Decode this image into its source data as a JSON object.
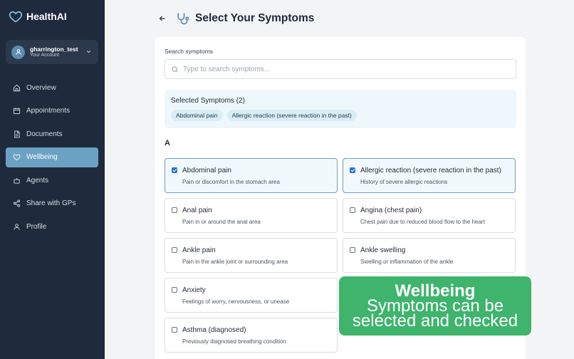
{
  "app": {
    "name": "HealthAI",
    "brand_color": "#7ec3e8"
  },
  "account": {
    "username": "gharrington_test",
    "subtitle": "Your Account"
  },
  "nav": {
    "items": [
      {
        "label": "Overview",
        "icon": "home-icon"
      },
      {
        "label": "Appointments",
        "icon": "calendar-icon"
      },
      {
        "label": "Documents",
        "icon": "document-icon"
      },
      {
        "label": "Wellbeing",
        "icon": "heart-icon",
        "active": true
      },
      {
        "label": "Agents",
        "icon": "robot-icon"
      },
      {
        "label": "Share with GPs",
        "icon": "share-icon"
      },
      {
        "label": "Profile",
        "icon": "user-icon"
      }
    ]
  },
  "header": {
    "title": "Select Your Symptoms"
  },
  "search": {
    "label": "Search symptoms",
    "placeholder": "Type to search symptoms...",
    "value": ""
  },
  "selected": {
    "title": "Selected Symptoms (2)",
    "chips": [
      "Abdominal pain",
      "Allergic reaction (severe reaction in the past)"
    ]
  },
  "section": {
    "letter": "A"
  },
  "symptoms": [
    {
      "title": "Abdominal pain",
      "desc": "Pain or discomfort in the stomach area",
      "checked": true
    },
    {
      "title": "Allergic reaction (severe reaction in the past)",
      "desc": "History of severe allergic reactions",
      "checked": true
    },
    {
      "title": "Anal pain",
      "desc": "Pain in or around the anal area",
      "checked": false
    },
    {
      "title": "Angina (chest pain)",
      "desc": "Chest pain due to reduced blood flow to the heart",
      "checked": false
    },
    {
      "title": "Ankle pain",
      "desc": "Pain in the ankle joint or surrounding area",
      "checked": false
    },
    {
      "title": "Ankle swelling",
      "desc": "Swelling or inflammation of the ankle",
      "checked": false
    },
    {
      "title": "Anxiety",
      "desc": "Feelings of worry, nervousness, or unease",
      "checked": false
    },
    {
      "title": "Asthma (diagnosed)",
      "desc": "Previously diagnosed breathing condition",
      "checked": false
    }
  ],
  "overlay": {
    "title": "Wellbeing",
    "line1": "Symptoms can be",
    "line2": "selected and checked",
    "color": "#3eb46d"
  }
}
